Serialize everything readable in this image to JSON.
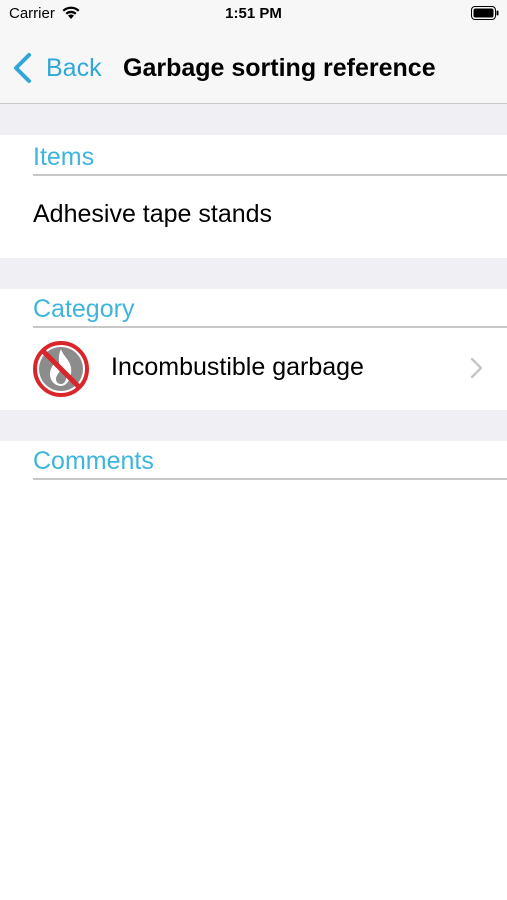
{
  "status_bar": {
    "carrier": "Carrier",
    "time": "1:51 PM",
    "icons": [
      "wifi-icon",
      "battery-icon"
    ]
  },
  "nav": {
    "back_label": "Back",
    "title": "Garbage sorting reference",
    "accent_color": "#2fa8d8"
  },
  "sections": {
    "items": {
      "header": "Items",
      "value": "Adhesive tape stands"
    },
    "category": {
      "header": "Category",
      "value": "Incombustible garbage",
      "icon": "no-fire-icon"
    },
    "comments": {
      "header": "Comments",
      "value": ""
    }
  },
  "colors": {
    "section_header": "#3eb5dc",
    "separator_background": "#efeff4",
    "prohibition_red": "#d9262b"
  }
}
